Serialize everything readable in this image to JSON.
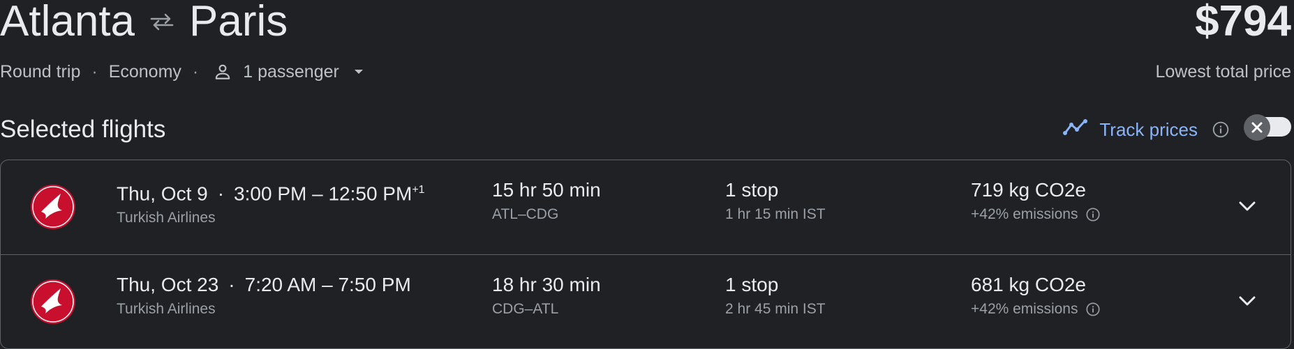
{
  "header": {
    "origin": "Atlanta",
    "destination": "Paris",
    "price": "$794",
    "price_caption": "Lowest total price",
    "trip_type": "Round trip",
    "cabin": "Economy",
    "passengers": "1 passenger"
  },
  "section": {
    "title": "Selected flights",
    "track_label": "Track prices"
  },
  "flights": [
    {
      "date": "Thu, Oct 9",
      "times": "3:00 PM – 12:50 PM",
      "day_offset": "+1",
      "airline": "Turkish Airlines",
      "duration": "15 hr 50 min",
      "route": "ATL–CDG",
      "stops": "1 stop",
      "layover": "1 hr 15 min IST",
      "emissions": "719 kg CO2e",
      "emissions_delta": "+42% emissions"
    },
    {
      "date": "Thu, Oct 23",
      "times": "7:20 AM – 7:50 PM",
      "day_offset": "",
      "airline": "Turkish Airlines",
      "duration": "18 hr 30 min",
      "route": "CDG–ATL",
      "stops": "1 stop",
      "layover": "2 hr 45 min IST",
      "emissions": "681 kg CO2e",
      "emissions_delta": "+42% emissions"
    }
  ],
  "colors": {
    "background": "#202124",
    "accent": "#8ab4f8",
    "airline_red": "#c8102e"
  },
  "icons": {
    "swap": "swap-arrows-icon",
    "person": "person-icon",
    "caret": "caret-down-icon",
    "trend": "trend-line-icon",
    "info": "info-icon",
    "close": "close-icon",
    "logo": "turkish-airlines-logo",
    "expand": "chevron-down-icon"
  }
}
